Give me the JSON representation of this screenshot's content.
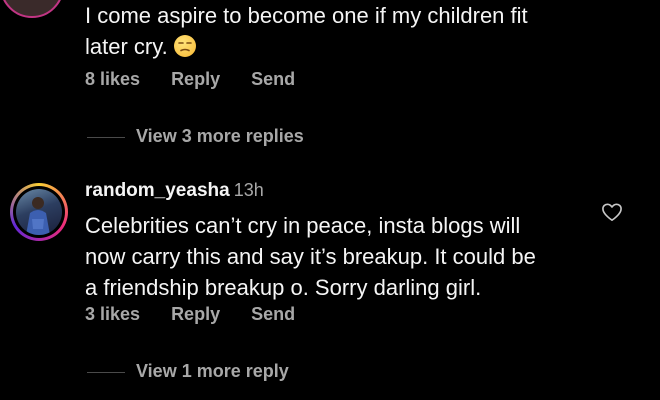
{
  "comment1": {
    "lines": [
      "I come aspire to become one if my children fit",
      "later cry."
    ],
    "emoji": "unamused-face",
    "likes": "8 likes",
    "reply": "Reply",
    "send": "Send",
    "view_more": "View 3 more replies"
  },
  "comment2": {
    "username": "random_yeasha",
    "time": "13h",
    "lines": [
      "Celebrities can’t cry in peace, insta blogs will",
      "now carry this and say it’s breakup. It could be",
      "a friendship breakup o. Sorry darling girl."
    ],
    "likes": "3 likes",
    "reply": "Reply",
    "send": "Send",
    "view_more": "View 1 more reply"
  },
  "colors": {
    "background": "#000000",
    "text": "#f5f5f5",
    "muted": "#a8a8a8"
  },
  "icons": [
    "unamused-emoji-icon",
    "heart-icon",
    "avatar"
  ]
}
